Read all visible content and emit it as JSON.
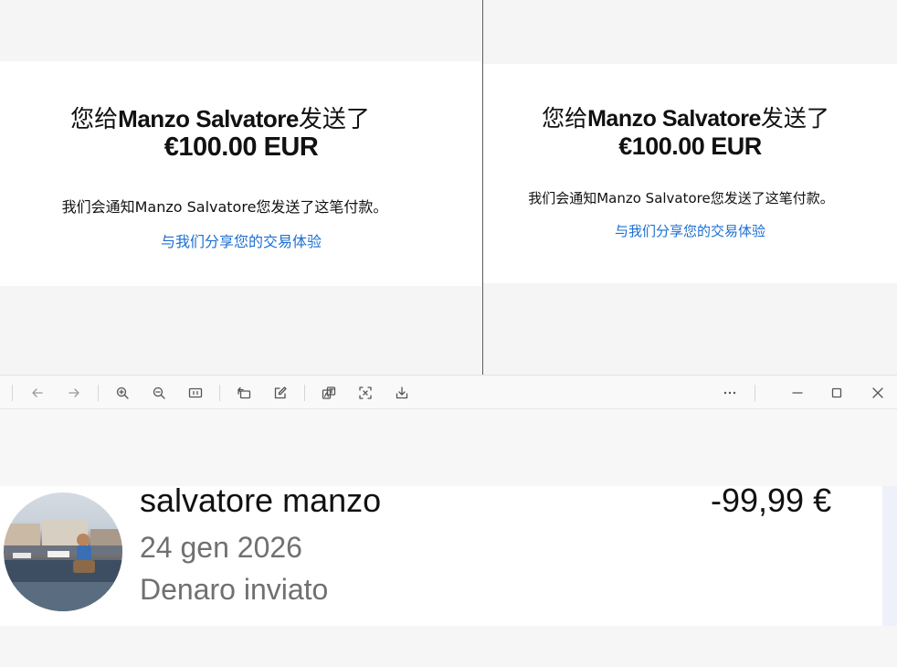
{
  "left_confirmation": {
    "prefix": "您给",
    "recipient": "Manzo Salvatore",
    "suffix": "发送了",
    "amount": "€100.00 EUR",
    "notice": "我们会通知Manzo Salvatore您发送了这笔付款。",
    "share_link": "与我们分享您的交易体验"
  },
  "right_confirmation": {
    "prefix": "您给",
    "recipient": "Manzo Salvatore",
    "suffix": "发送了",
    "amount": "€100.00 EUR",
    "notice": "我们会通知Manzo Salvatore您发送了这笔付款。",
    "share_link": "与我们分享您的交易体验"
  },
  "viewer_toolbar": {
    "icons": [
      "back-arrow-icon",
      "forward-arrow-icon",
      "zoom-in-icon",
      "zoom-out-icon",
      "actual-size-icon",
      "rotate-icon",
      "edit-icon",
      "translate-icon",
      "scan-text-icon",
      "save-icon",
      "more-icon",
      "minimize-icon",
      "maximize-icon",
      "close-icon"
    ]
  },
  "transaction": {
    "name": "salvatore manzo",
    "amount": "-99,99 €",
    "date": "24 gen 2026",
    "status": "Denaro inviato"
  },
  "colors": {
    "link": "#1b6fd1",
    "text": "#111111",
    "muted": "#707070",
    "card_bg": "#ffffff",
    "page_bg": "#f6f6f6"
  }
}
